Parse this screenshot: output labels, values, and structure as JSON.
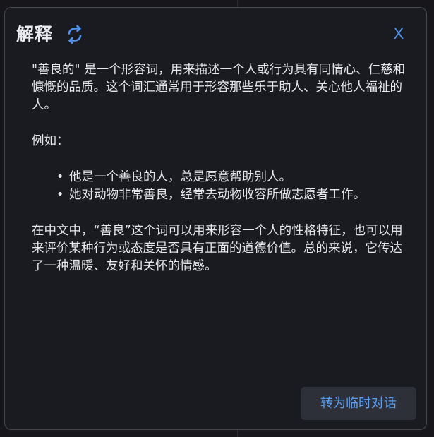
{
  "dialog": {
    "title": "解释",
    "refresh_icon": "refresh-cycle-icon",
    "close_label": "X",
    "accent_color": "#4f93ef"
  },
  "explanation": {
    "intro": "\"善良的\" 是一个形容词，用来描述一个人或行为具有同情心、仁慈和慷慨的品质。这个词汇通常用于形容那些乐于助人、关心他人福祉的人。",
    "example_heading": "例如：",
    "examples": [
      "他是一个善良的人，总是愿意帮助别人。",
      "她对动物非常善良，经常去动物收容所做志愿者工作。"
    ],
    "summary": "在中文中，“善良”这个词可以用来形容一个人的性格特征，也可以用来评价某种行为或态度是否具有正面的道德价值。总的来说，它传达了一种温暖、友好和关怀的情感。"
  },
  "footer": {
    "convert_label": "转为临时对话"
  }
}
